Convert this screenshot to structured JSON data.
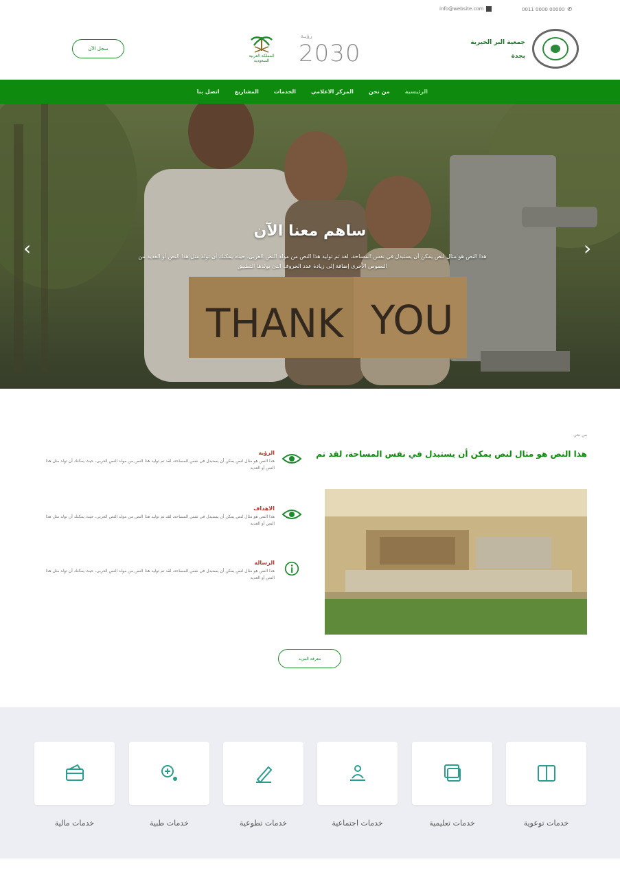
{
  "topbar": {
    "email": "info@website.com",
    "phone": "0011 0000 00000"
  },
  "header": {
    "brand_line1": "جمعية البر الخيرية",
    "brand_line2": "بجدة",
    "vision_top": "رؤيـة",
    "vision_number": "2030",
    "vision_emblem_text": "المملكة العربية السعودية",
    "login_label": "سجل الآن"
  },
  "nav": {
    "items": [
      "الرئيسية",
      "من نحن",
      "المركز الاعلامي",
      "الخدمات",
      "المشاريع",
      "اتصل بنا"
    ]
  },
  "hero": {
    "title": "ساهم معنا الآن",
    "text": "هذا النص هو مثال لنص يمكن أن يستبدل في نفس المساحة، لقد تم توليد هذا النص من مولد النص العربى، حيث يمكنك أن تولد مثل هذا النص أو العديد من النصوص الأخرى إضافة إلى زيادة عدد الحروف التى يولدها التطبيق",
    "sign_text": "THANK YOU"
  },
  "about": {
    "breadcrumb": "من نحن",
    "title": "هذا النص هو مثال لنص يمكن أن يستبدل في نفس المساحة، لقد تم",
    "features": [
      {
        "title": "الرؤية",
        "text": "هذا النص هو مثال لنص يمكن أن يستبدل في نفس المساحة، لقد تم توليد هذا النص من مولد النص العربى، حيث يمكنك أن تولد مثل هذا النص أو العديد",
        "icon": "eye-icon"
      },
      {
        "title": "الاهداف",
        "text": "هذا النص هو مثال لنص يمكن أن يستبدل في نفس المساحة، لقد تم توليد هذا النص من مولد النص العربى، حيث يمكنك أن تولد مثل هذا النص أو العديد",
        "icon": "eye-icon"
      },
      {
        "title": "الرسالة",
        "text": "هذا النص هو مثال لنص يمكن أن يستبدل في نفس المساحة، لقد تم توليد هذا النص من مولد النص العربى، حيث يمكنك أن تولد مثل هذا النص أو العديد",
        "icon": "info-icon"
      }
    ],
    "more_label": "معرفة المزيد"
  },
  "services": {
    "items": [
      {
        "label": "خدمات توعوية",
        "icon": "book-icon"
      },
      {
        "label": "خدمات تعليمية",
        "icon": "board-icon"
      },
      {
        "label": "خدمات اجتماعية",
        "icon": "people-icon"
      },
      {
        "label": "خدمات تطوعية",
        "icon": "pen-icon"
      },
      {
        "label": "خدمات طبية",
        "icon": "medical-icon"
      },
      {
        "label": "خدمات مالية",
        "icon": "wallet-icon"
      }
    ]
  },
  "colors": {
    "primary": "#0e8a0e",
    "accent": "#c0392b",
    "services_bg": "#eceef3"
  }
}
